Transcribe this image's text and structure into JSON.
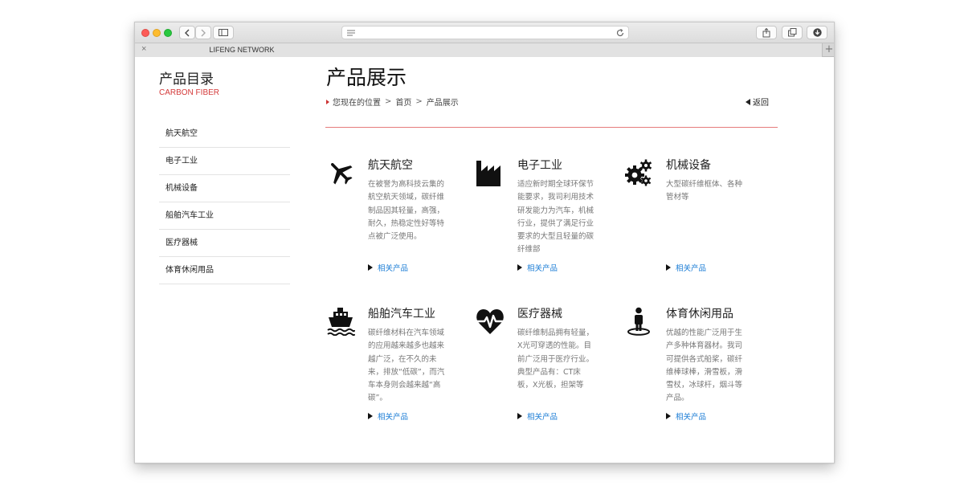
{
  "browser": {
    "tab_title": "LIFENG NETWORK",
    "tab_close": "×",
    "new_tab": "+"
  },
  "sidebar": {
    "title": "产品目录",
    "subtitle": "CARBON FIBER",
    "items": [
      {
        "label": "航天航空"
      },
      {
        "label": "电子工业"
      },
      {
        "label": "机械设备"
      },
      {
        "label": "船舶汽车工业"
      },
      {
        "label": "医疗器械"
      },
      {
        "label": "体育休闲用品"
      }
    ]
  },
  "main": {
    "title": "产品展示",
    "breadcrumb": {
      "prefix": "您现在的位置",
      "home": "首页",
      "current": "产品展示"
    },
    "back_label": "返回",
    "more_label": "相关产品",
    "cards": [
      {
        "title": "航天航空",
        "icon": "airplane-icon",
        "desc": "在被誉为高科技云集的航空航天领域，碳纤维制品因其轻量，高强，耐久，热稳定性好等特点被广泛使用。"
      },
      {
        "title": "电子工业",
        "icon": "factory-icon",
        "desc": "适应新时期全球环保节能要求，我司利用技术研发能力为汽车，机械行业，提供了满足行业要求的大型且轻量的碳纤维部"
      },
      {
        "title": "机械设备",
        "icon": "gears-icon",
        "desc": "大型碳纤维框体、各种管材等"
      },
      {
        "title": "船舶汽车工业",
        "icon": "ship-icon",
        "desc": "碳纤维材料在汽车领域的应用越来越多也越来越广泛，在不久的未来，排放“低碳”，而汽车本身则会越来越“高碳”。"
      },
      {
        "title": "医疗器械",
        "icon": "heartbeat-icon",
        "desc": "碳纤维制品拥有轻量，X光可穿透的性能。目前广泛用于医疗行业。典型产品有：CT床板，X光板，担架等"
      },
      {
        "title": "体育休闲用品",
        "icon": "person-icon",
        "desc": "优越的性能广泛用于生产多种体育器材。我司可提供各式船桨，碳纤维棒球棒，滑雪板，滑雪杖，冰球杆，烟斗等产品。"
      }
    ]
  }
}
